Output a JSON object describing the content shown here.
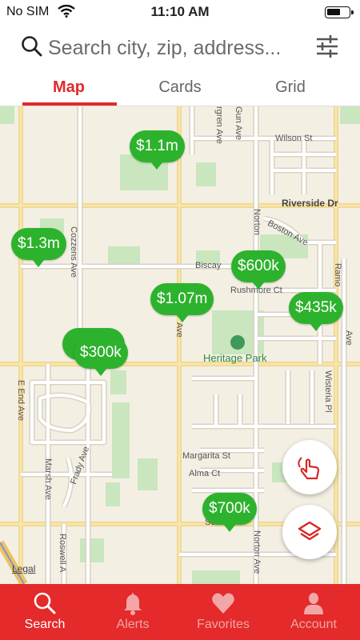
{
  "status_bar": {
    "carrier": "No SIM",
    "time": "11:10 AM"
  },
  "search": {
    "placeholder": "Search city, zip, address..."
  },
  "tabs": [
    {
      "label": "Map",
      "active": true
    },
    {
      "label": "Cards",
      "active": false
    },
    {
      "label": "Grid",
      "active": false
    }
  ],
  "map": {
    "streets": {
      "wilson": "Wilson St",
      "riverside": "Riverside Dr",
      "boston": "Boston Ave",
      "biscay": "Biscay",
      "rushmore": "Rushmore Ct",
      "norton_n": "Norton",
      "norton_s": "Norton Ave",
      "gun": "Gun Ave",
      "evergreen": "rgren Ave",
      "cozzens": "Cozzens Ave",
      "e_end": "E End Ave",
      "marsh": "Marsh Ave",
      "frady": "Frady Ave",
      "roswell": "Roswell A",
      "margarita": "Margarita St",
      "alma": "Alma Ct",
      "scha": "Scha",
      "ave_mid": "Ave",
      "ramo": "Ramo",
      "wisteria": "Wisteria Pl",
      "ave_right": "Ave"
    },
    "park": "Heritage Park",
    "legal": "Legal",
    "pins": [
      "$1.1m",
      "$1.3m",
      "$600k",
      "$1.07m",
      "$435k",
      "$300k",
      "$700k"
    ],
    "pin_color": "#2db22d"
  },
  "fabs": {
    "gesture_icon": "hand-draw-icon",
    "layers_icon": "layers-icon"
  },
  "bottom_nav": {
    "background": "#e42a2a",
    "items": [
      {
        "label": "Search",
        "icon": "search-icon",
        "active": true
      },
      {
        "label": "Alerts",
        "icon": "bell-icon",
        "active": false
      },
      {
        "label": "Favorites",
        "icon": "heart-icon",
        "active": false
      },
      {
        "label": "Account",
        "icon": "person-icon",
        "active": false
      }
    ]
  }
}
